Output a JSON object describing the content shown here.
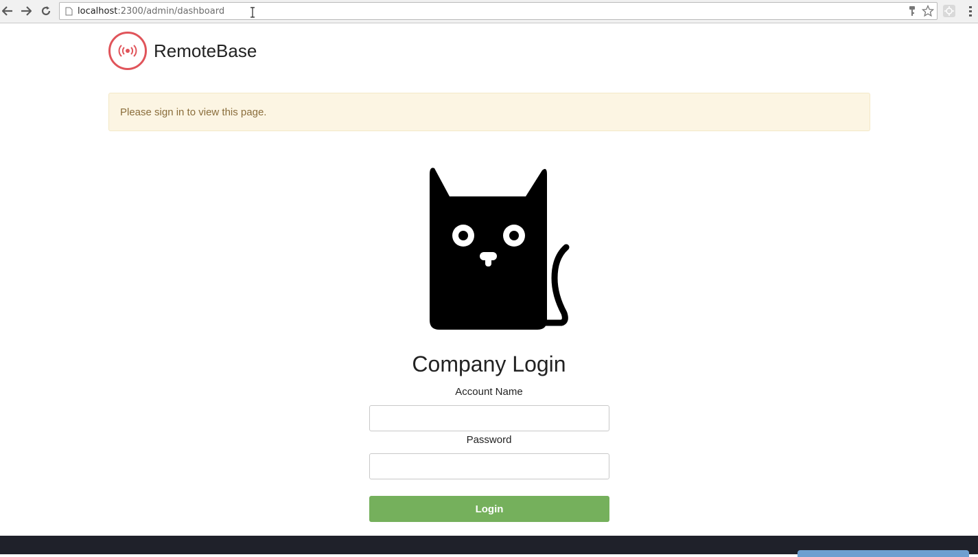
{
  "browser": {
    "url_host": "localhost",
    "url_rest": ":2300/admin/dashboard"
  },
  "header": {
    "brand_name": "RemoteBase"
  },
  "alert": {
    "message": "Please sign in to view this page."
  },
  "login": {
    "title": "Company Login",
    "account_label": "Account Name",
    "account_value": "",
    "password_label": "Password",
    "password_value": "",
    "submit_label": "Login"
  },
  "colors": {
    "brand_red": "#e0545a",
    "alert_bg": "#fcf5e3",
    "alert_text": "#8a6d3b",
    "login_button": "#75b05c",
    "footer_bg": "#1f212a"
  },
  "icons": {
    "back": "arrow-left-icon",
    "forward": "arrow-right-icon",
    "reload": "reload-icon",
    "page": "page-icon",
    "key": "key-icon",
    "star": "star-icon",
    "extension": "extension-icon",
    "logo": "broadcast-icon",
    "cat": "cat-illustration"
  }
}
